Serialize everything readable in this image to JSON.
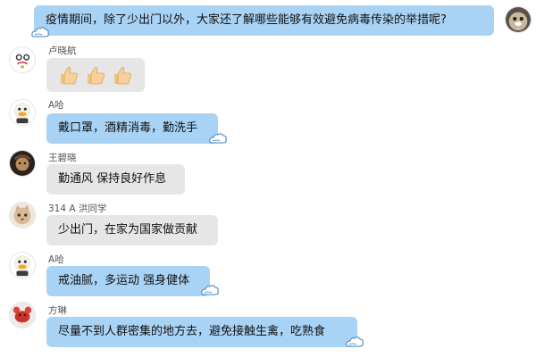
{
  "chat": {
    "messages": [
      {
        "sender": "",
        "text": "疫情期间，除了少出门以外，大家还了解哪些能够有效避免病毒传染的举措呢?",
        "avatar_icon": "beaver-avatar-icon",
        "own": true,
        "style": "blue"
      },
      {
        "sender": "卢晓航",
        "text": "",
        "emoji": [
          "thumbs-up",
          "thumbs-up",
          "thumbs-up"
        ],
        "avatar_icon": "cartoon-face-avatar-icon",
        "style": "gray"
      },
      {
        "sender": "A哈",
        "text": "戴口罩，酒精消毒，勤洗手",
        "avatar_icon": "duck-avatar-icon",
        "style": "blue"
      },
      {
        "sender": "王碧晓",
        "text": "勤通风 保持良好作息",
        "avatar_icon": "dark-photo-avatar-icon",
        "style": "gray"
      },
      {
        "sender": "314 A 洪同学",
        "text": "少出门，在家为国家做贡献",
        "avatar_icon": "cat-avatar-icon",
        "style": "gray"
      },
      {
        "sender": "A哈",
        "text": "戒油腻，多运动 强身健体",
        "avatar_icon": "duck-avatar-icon",
        "style": "blue"
      },
      {
        "sender": "方琳",
        "text": "尽量不到人群密集的地方去，避免接触生禽，吃熟食",
        "avatar_icon": "red-lobster-avatar-icon",
        "style": "blue"
      }
    ]
  },
  "colors": {
    "blue_bubble": "#a9d3f5",
    "gray_bubble": "#e6e6e6",
    "name_text": "#555555"
  }
}
